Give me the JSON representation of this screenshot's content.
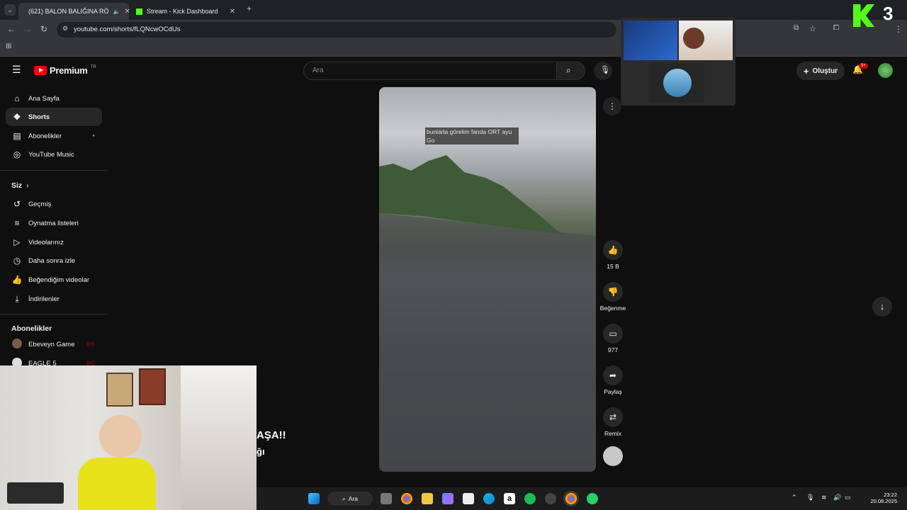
{
  "browser": {
    "tabs": [
      {
        "title": "(621) BALON BALIĞINA RÖ",
        "active": true
      },
      {
        "title": "Stream - Kick Dashboard",
        "active": false
      }
    ],
    "url": "youtube.com/shorts/fLQNcwOCdUs"
  },
  "youtube": {
    "logo_text": "Premium",
    "logo_badge": "TR",
    "search_placeholder": "Ara",
    "create_label": "Oluştur",
    "notifications_badge": "9+"
  },
  "sidebar": {
    "main_items": [
      {
        "label": "Ana Sayfa",
        "icon": "home-icon"
      },
      {
        "label": "Shorts",
        "icon": "shorts-icon",
        "active": true
      },
      {
        "label": "Abonelikler",
        "icon": "subscriptions-icon"
      },
      {
        "label": "YouTube Music",
        "icon": "youtube-music-icon"
      }
    ],
    "you_heading": "Siz",
    "you_items": [
      {
        "label": "Geçmiş",
        "icon": "history-icon"
      },
      {
        "label": "Oynatma listeleri",
        "icon": "playlists-icon"
      },
      {
        "label": "Videolarınız",
        "icon": "your-videos-icon"
      },
      {
        "label": "Daha sonra izle",
        "icon": "watch-later-icon"
      },
      {
        "label": "Beğendiğim videolar",
        "icon": "liked-videos-icon"
      },
      {
        "label": "İndirilenler",
        "icon": "downloads-icon"
      }
    ],
    "subs_heading": "Abonelikler",
    "subscriptions": [
      {
        "label": "Ebeveyn Game"
      },
      {
        "label": "EAGLE 5"
      }
    ]
  },
  "short": {
    "caption": "bunlarla görelim fanda ORT ayu Go",
    "likes": "15 B",
    "dislike_label": "Beğenme",
    "comments": "977",
    "share_label": "Paylaş",
    "remix_label": "Remix"
  },
  "overlay": {
    "webcam_text_1": "AŞA!!",
    "webcam_text_2": "ğı",
    "stream_number": "3"
  },
  "taskbar": {
    "search_label": "Ara",
    "time": "23:22",
    "date": "20.08.2025"
  },
  "colors": {
    "yt_red": "#ff0000",
    "kick_green": "#53fc18",
    "background": "#0f0f0f"
  }
}
